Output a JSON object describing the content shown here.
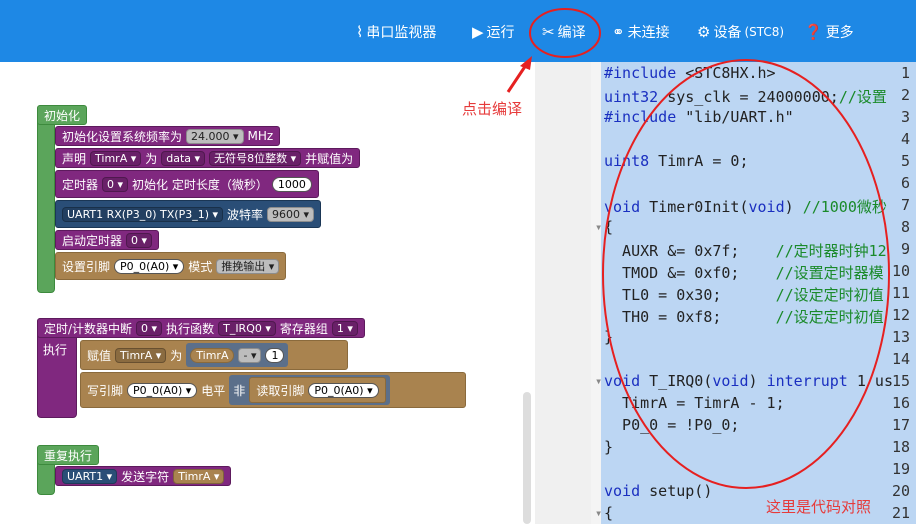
{
  "toolbar": {
    "serial_monitor": "串口监视器",
    "run": "运行",
    "compile": "编译",
    "disconnected": "未连接",
    "device": "设备",
    "device_model": "(STC8)",
    "more": "更多"
  },
  "blocks": {
    "init_hat": "初始化",
    "set_freq_label": "初始化设置系统频率为",
    "set_freq_value": "24.000",
    "set_freq_unit": "MHz",
    "declare": "声明",
    "var_name": "TimrA",
    "as": "为",
    "data_kw": "data",
    "type": "无符号8位整数",
    "assign": "并赋值为",
    "timer": "定时器",
    "timer_num": "0",
    "timer_init": "初始化 定时长度（微秒）",
    "timer_len": "1000",
    "uart": "UART1 RX(P3_0) TX(P3_1)",
    "baud_label": "波特率",
    "baud": "9600",
    "start_timer": "启动定时器",
    "start_timer_num": "0",
    "set_pin": "设置引脚",
    "pin": "P0_0(A0)",
    "mode": "模式",
    "mode_value": "推挽输出",
    "isr_label": "定时/计数器中断",
    "isr_num": "0",
    "exec_func": "执行函数",
    "func_name": "T_IRQ0",
    "reg_group": "寄存器组",
    "reg_num": "1",
    "exec": "执行",
    "assign_value": "赋值",
    "minus": "-",
    "one": "1",
    "write_pin": "写引脚",
    "level": "电平",
    "not": "非",
    "read_pin": "读取引脚",
    "loop": "重复执行",
    "uart1": "UART1",
    "send_char": "发送字符"
  },
  "code": {
    "lines": [
      "1",
      "2",
      "3",
      "4",
      "5",
      "6",
      "7",
      "8",
      "9",
      "10",
      "11",
      "12",
      "13",
      "14",
      "15",
      "16",
      "17",
      "18",
      "19",
      "20",
      "21"
    ],
    "l1a": "#include",
    "l1b": " <STC8HX.h>",
    "l2a": "uint32",
    "l2b": " sys_clk = 24000000;",
    "l2c": "//设置",
    "l3a": "#include",
    "l3b": " \"lib/UART.h\"",
    "l5a": "uint8",
    "l5b": " TimrA = 0;",
    "l7a": "void",
    "l7b": " Timer0Init(",
    "l7c": "void",
    "l7d": ") ",
    "l7e": "//1000微秒",
    "l8": "{",
    "l9a": "  AUXR &= 0x7f;    ",
    "l9b": "//定时器时钟12",
    "l10a": "  TMOD &= 0xf0;    ",
    "l10b": "//设置定时器模",
    "l11a": "  TL0 = 0x30;      ",
    "l11b": "//设定定时初值",
    "l12a": "  TH0 = 0xf8;      ",
    "l12b": "//设定定时初值",
    "l13": "}",
    "l15a": "void",
    "l15b": " T_IRQ0(",
    "l15c": "void",
    "l15d": ") ",
    "l15e": "interrupt",
    "l15f": " 1 us",
    "l16": "  TimrA = TimrA - 1;",
    "l17": "  P0_0 = !P0_0;",
    "l18": "}",
    "l20a": "void",
    "l20b": " setup()",
    "l21": "{"
  },
  "annotations": {
    "click_compile": "点击编译",
    "code_compare": "这里是代码对照"
  }
}
